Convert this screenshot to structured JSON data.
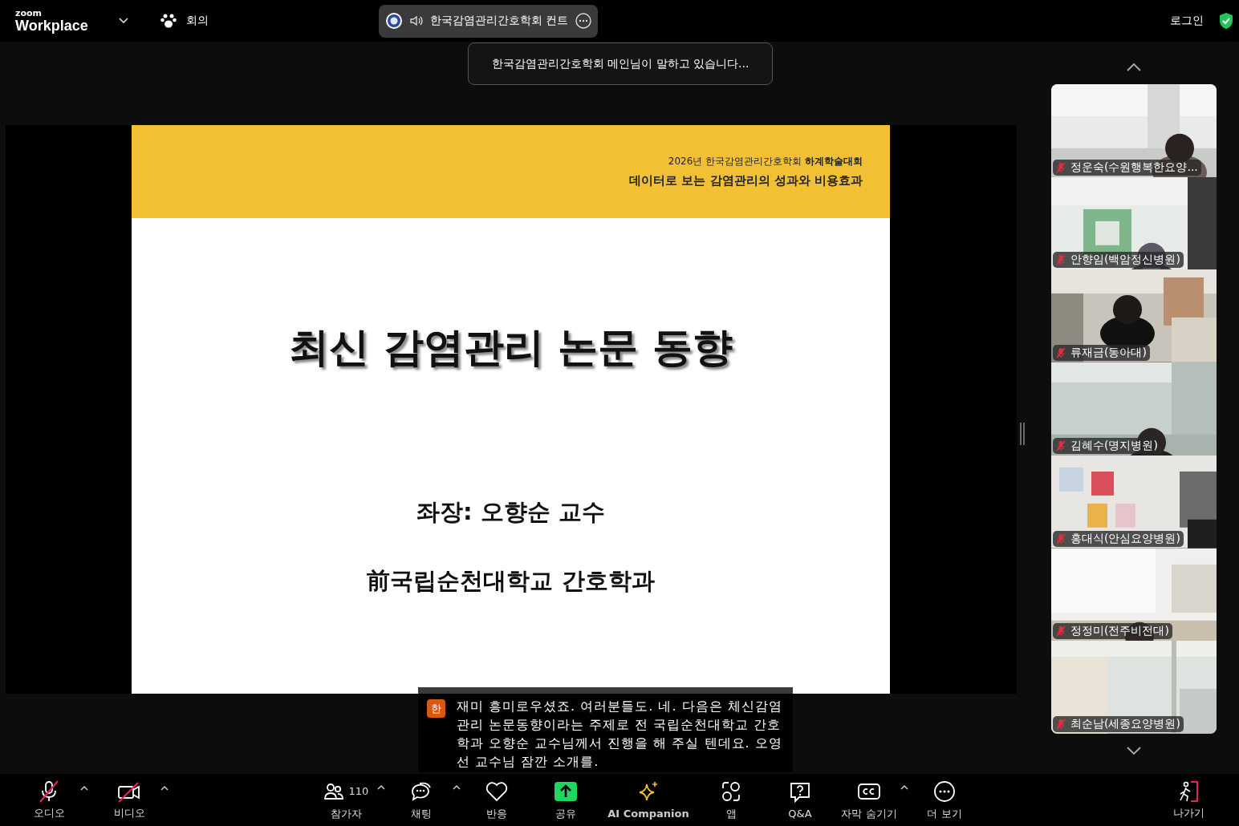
{
  "top_bar": {
    "logo_small": "zoom",
    "logo_large": "Workplace",
    "meeting_menu": "회의",
    "meeting_pill": {
      "title": "한국감염관리간호학회 컨트"
    },
    "login": "로그인"
  },
  "speaking_notice": "한국감염관리간호학회 메인님이 말하고 있습니다...",
  "slide": {
    "header_line": "2026년 한국감염관리간호학회 **하계학술대회**",
    "header_title": "데이터로 보는 감염관리의 성과와 비용효과",
    "title": "최신 감염관리 논문 동향",
    "chair": "좌장: 오향순 교수",
    "affiliation": "前국립순천대학교 간호학과"
  },
  "caption": {
    "badge": "한",
    "text": "재미 흥미로우셨죠. 여러분들도. 네. 다음은 체신감염관리 논문동향이라는 주제로 전 국립순천대학교 간호학과 오향순 교수님께서 진행을 해 주실 텐데요. 오영선 교수님 잠깐 소개를."
  },
  "participants": [
    {
      "name": "정운숙(수원행복한요양...",
      "muted": true
    },
    {
      "name": "안향임(백암정신병원)",
      "muted": true
    },
    {
      "name": "류재금(동아대)",
      "muted": true
    },
    {
      "name": "김혜수(명지병원)",
      "muted": true
    },
    {
      "name": "홍대식(안심요양병원)",
      "muted": true
    },
    {
      "name": "정정미(전주비전대)",
      "muted": true
    },
    {
      "name": "최순남(세종요양병원)",
      "muted": true
    }
  ],
  "toolbar": [
    {
      "kind": "audio",
      "label": "오디오",
      "muted": true,
      "menu": true
    },
    {
      "kind": "video",
      "label": "비디오",
      "muted": true,
      "menu": true
    },
    {
      "kind": "participants",
      "label": "참가자",
      "count": "110",
      "menu": true
    },
    {
      "kind": "chat",
      "label": "채팅",
      "menu": true
    },
    {
      "kind": "reactions",
      "label": "반응",
      "menu": false
    },
    {
      "kind": "share",
      "label": "공유",
      "menu": false
    },
    {
      "kind": "ai",
      "label": "AI Companion",
      "menu": false
    },
    {
      "kind": "apps",
      "label": "앱",
      "menu": false
    },
    {
      "kind": "qa",
      "label": "Q&A",
      "menu": false
    },
    {
      "kind": "captions",
      "label": "자막 숨기기",
      "menu": true
    },
    {
      "kind": "more",
      "label": "더 보기",
      "menu": false
    },
    {
      "kind": "leave",
      "label": "나가기"
    }
  ]
}
